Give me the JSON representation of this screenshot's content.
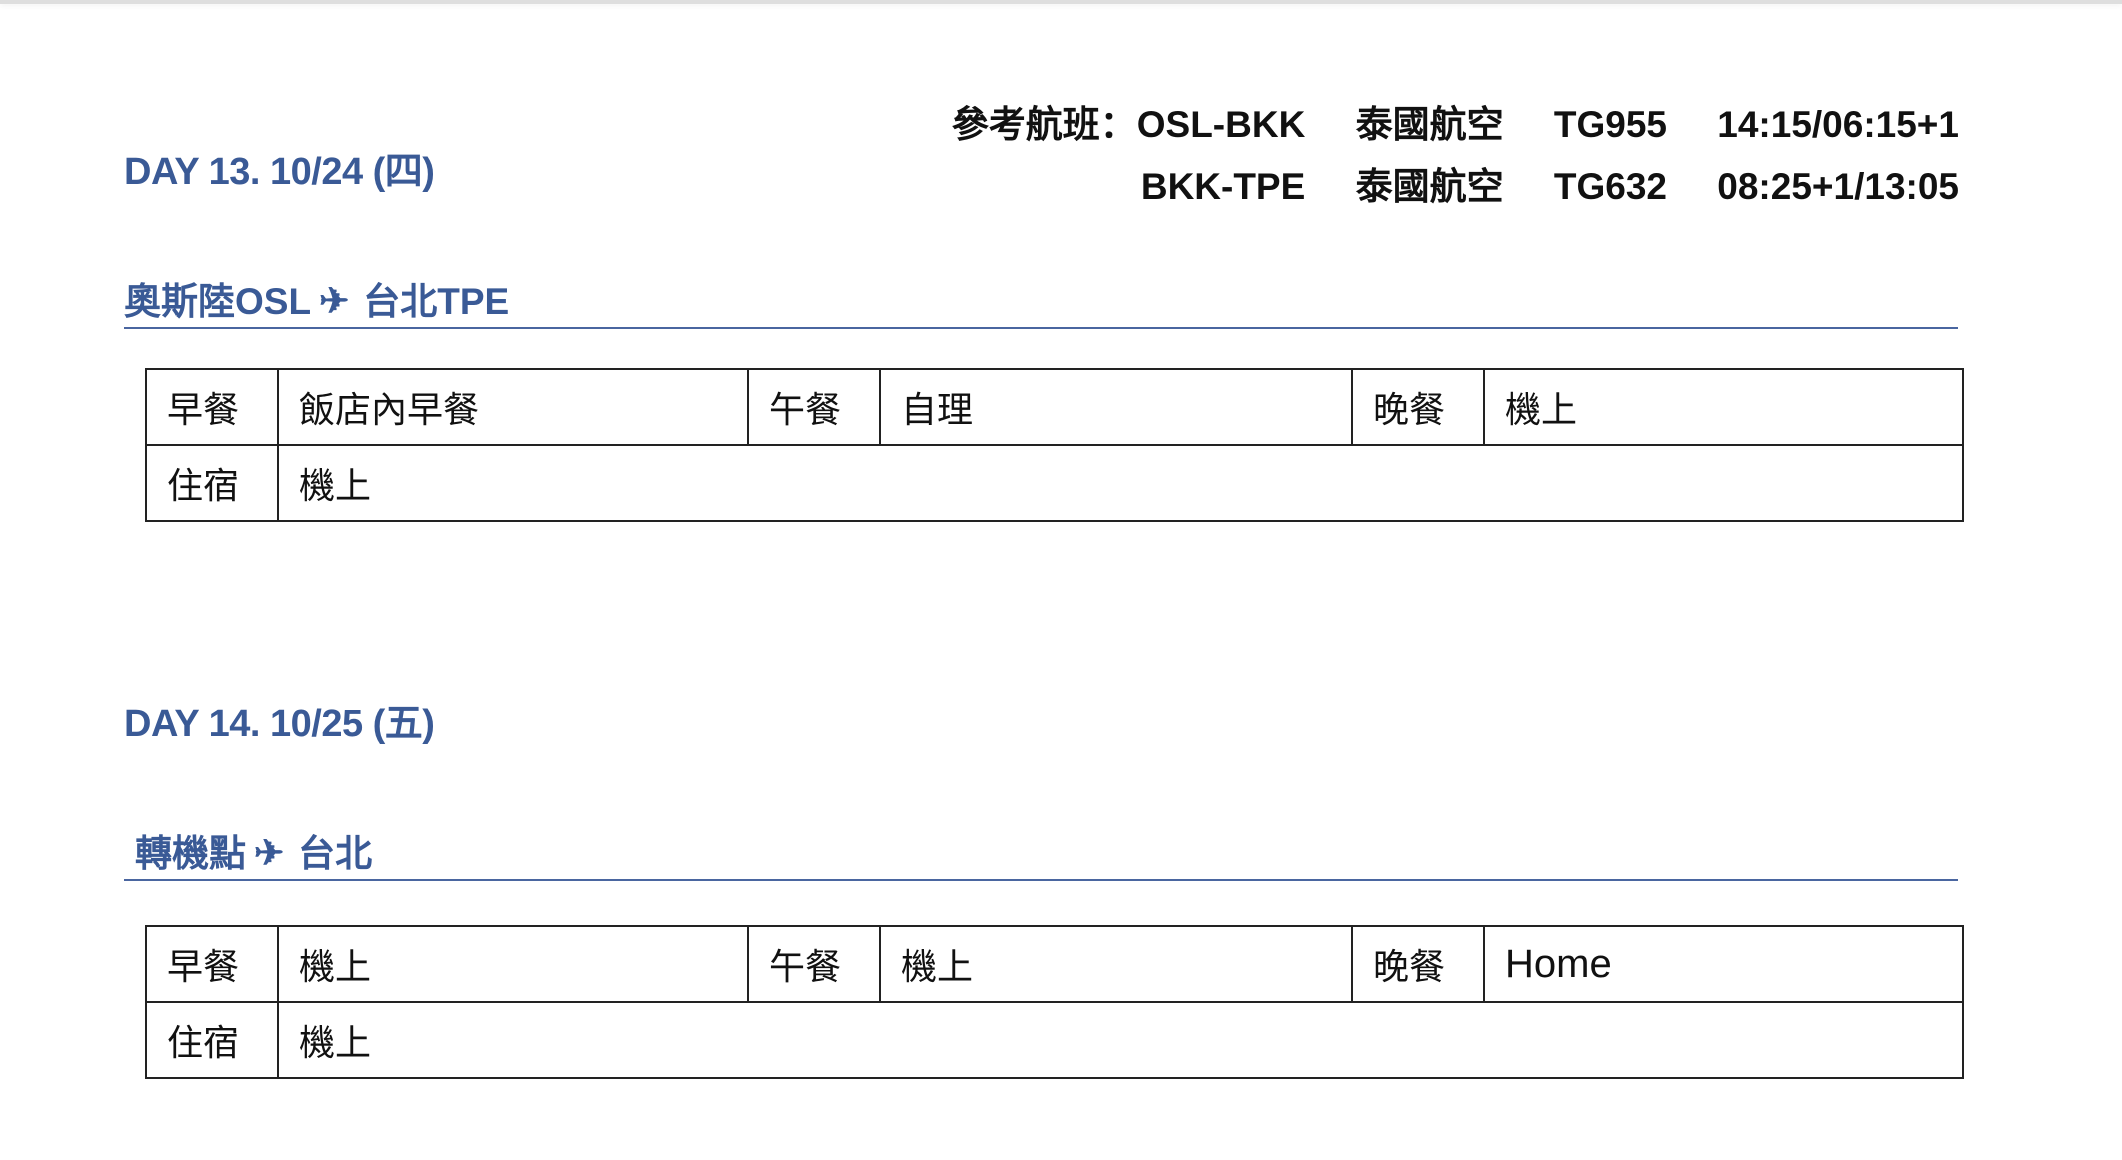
{
  "days": [
    {
      "heading": "DAY 13. 10/24 (四)",
      "flights": {
        "label": "參考航班：",
        "lines": [
          {
            "route": "OSL-BKK",
            "airline": "泰國航空",
            "flight_no": "TG955",
            "time": "14:15/06:15+1"
          },
          {
            "route": "BKK-TPE",
            "airline": "泰國航空",
            "flight_no": "TG632",
            "time": "08:25+1/13:05"
          }
        ]
      },
      "route": {
        "from": "奧斯陸OSL",
        "plane_icon": "✈",
        "to": "台北TPE"
      },
      "meals": {
        "breakfast_label": "早餐",
        "breakfast": "飯店內早餐",
        "lunch_label": "午餐",
        "lunch": "自理",
        "dinner_label": "晚餐",
        "dinner": "機上",
        "lodging_label": "住宿",
        "lodging": "機上"
      }
    },
    {
      "heading": "DAY 14. 10/25 (五)",
      "route": {
        "from": "轉機點",
        "plane_icon": "✈",
        "to": "台北"
      },
      "meals": {
        "breakfast_label": "早餐",
        "breakfast": "機上",
        "lunch_label": "午餐",
        "lunch": "機上",
        "dinner_label": "晚餐",
        "dinner": "Home",
        "lodging_label": "住宿",
        "lodging": "機上"
      }
    }
  ],
  "colors": {
    "heading": "#3a5a96",
    "text": "#111111",
    "border": "#222222"
  }
}
